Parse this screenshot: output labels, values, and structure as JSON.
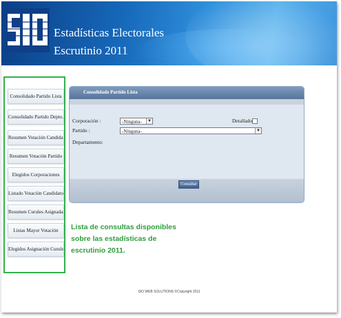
{
  "header": {
    "logo_text": "SIO",
    "title_line1": "Estadísticas Electorales",
    "title_line2": "Escrutinio 2011"
  },
  "sidebar": {
    "items": [
      {
        "label": "Consolidado Partido Lista"
      },
      {
        "label": "Consolidado Partido Depto."
      },
      {
        "label": "Resumen Votación Candidatos"
      },
      {
        "label": "Resumen Votación Partido"
      },
      {
        "label": "Elegidos Corporaciones"
      },
      {
        "label": "Listado Votación Candidatos"
      },
      {
        "label": "Resumen Curules Asignadas"
      },
      {
        "label": "Listas Mayor Votación"
      },
      {
        "label": "Elegidos Asignación Curules"
      }
    ]
  },
  "panel": {
    "title": "Consolidado Partido Lista",
    "corporacion_label": "Corporación :",
    "corporacion_value": "-Ninguna-",
    "detallado_label": "Detallado :",
    "partido_label": "Partido :",
    "partido_value": "-Ninguna-",
    "departamento_label": "Departamento:",
    "consultar_label": "Consultar"
  },
  "info": {
    "line1": "Lista de consultas disponibles",
    "line2": "sobre las estadísticas de",
    "line3": "escrutinio 2011."
  },
  "footer": {
    "text": "SIO WEB SOLUTIONS ©Copyright 2011"
  },
  "colors": {
    "header_blue": "#1667b8",
    "sidebar_border": "#2fb14a",
    "info_green": "#2f9e3c",
    "panel_header": "#56749b"
  }
}
